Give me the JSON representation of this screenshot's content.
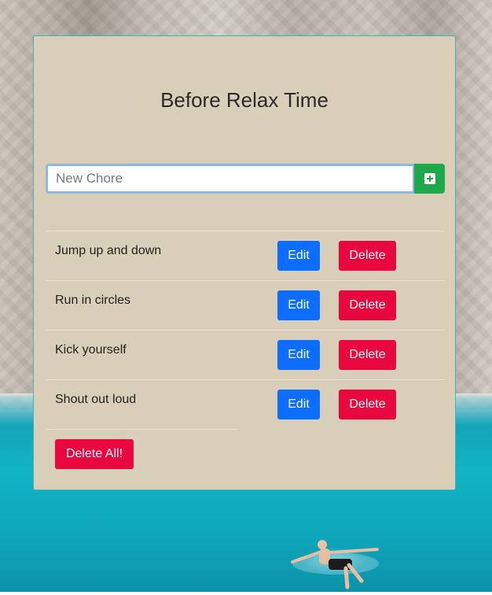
{
  "app": {
    "title": "Before Relax Time"
  },
  "new_chore": {
    "placeholder": "New Chore",
    "value": "",
    "add_icon": "plus-square-icon"
  },
  "chores": [
    {
      "name": "Jump up and down",
      "edit_label": "Edit",
      "delete_label": "Delete"
    },
    {
      "name": "Run in circles",
      "edit_label": "Edit",
      "delete_label": "Delete"
    },
    {
      "name": "Kick yourself",
      "edit_label": "Edit",
      "delete_label": "Delete"
    },
    {
      "name": "Shout out loud",
      "edit_label": "Edit",
      "delete_label": "Delete"
    }
  ],
  "actions": {
    "delete_all_label": "Delete All!"
  },
  "colors": {
    "card_background": "#d9cfb9",
    "edit_button": "#0d6efd",
    "delete_button": "#e8073e",
    "add_button": "#1ea84a"
  }
}
